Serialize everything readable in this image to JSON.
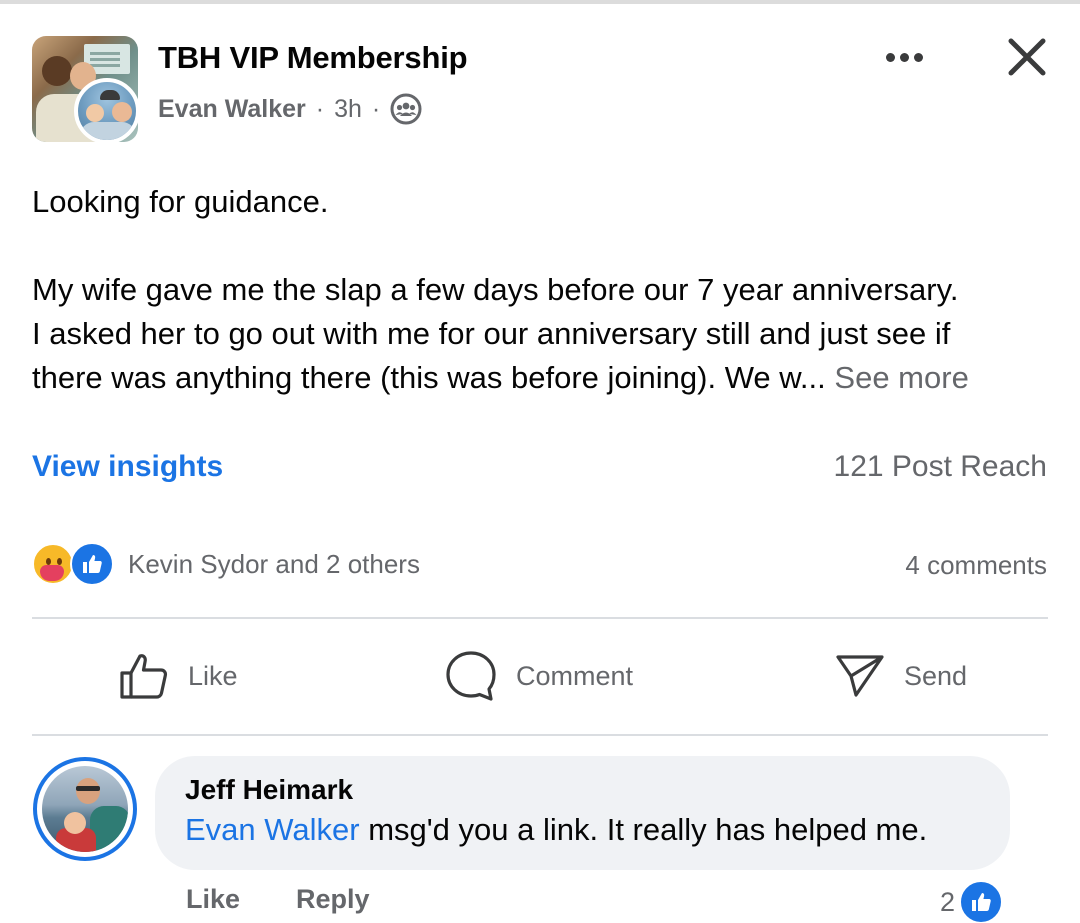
{
  "header": {
    "group_name": "TBH VIP Membership",
    "author": "Evan Walker",
    "separator": "·",
    "time": "3h",
    "privacy_icon": "group-members-icon"
  },
  "post": {
    "line1": "Looking for guidance.",
    "para_line1": "My wife gave me the slap a few days before our 7 year anniversary.",
    "para_line2": "I asked her to go out with me for our anniversary still and just see if",
    "para_line3": "there was anything there (this was before joining). We w...",
    "see_more": "See more"
  },
  "insights": {
    "link": "View insights",
    "reach": "121 Post Reach"
  },
  "reactions": {
    "icons": [
      "care-reaction-icon",
      "like-reaction-icon"
    ],
    "summary": "Kevin Sydor and 2 others",
    "comments": "4 comments"
  },
  "actions": {
    "like": "Like",
    "comment": "Comment",
    "send": "Send"
  },
  "comment": {
    "author": "Jeff Heimark",
    "mention": "Evan Walker",
    "text": " msg'd you a link. It really has helped me.",
    "like_label": "Like",
    "reply_label": "Reply",
    "reaction_count": "2"
  },
  "colors": {
    "accent": "#1b74e4",
    "secondary_text": "#65676b",
    "bubble": "#f0f2f5"
  }
}
